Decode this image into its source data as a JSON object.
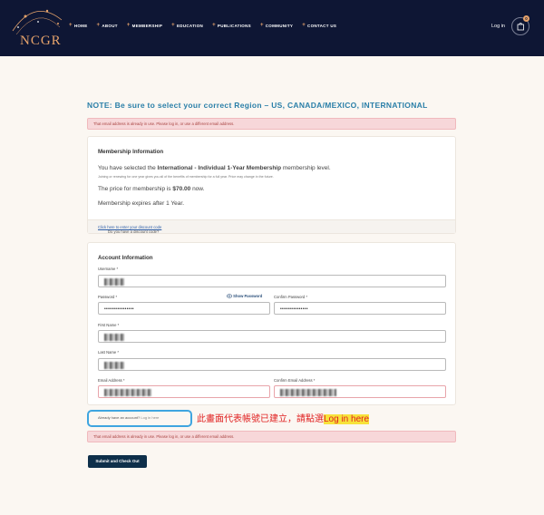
{
  "header": {
    "logo_text": "NCGR",
    "nav": [
      "HOME",
      "ABOUT",
      "MEMBERSHIP",
      "EDUCATION",
      "PUBLICATIONS",
      "COMMUNITY",
      "CONTACT US"
    ],
    "login": "Log in",
    "cart_count": "0",
    "bg_color": "#0e1634",
    "accent_color": "#e6a36b"
  },
  "notice": "NOTE: Be sure to select your correct Region – US, CANADA/MEXICO, INTERNATIONAL",
  "alert_text": "That email address is already in use. Please log in, or use a different email address.",
  "membership": {
    "title": "Membership Information",
    "selected_prefix": "You have selected the ",
    "level_name": "International - Individual 1-Year Membership",
    "selected_suffix": " membership level.",
    "fine_print": "Joining or renewing for one year gives you all of the benefits of membership for a full year. Price may change in the future.",
    "price_prefix": "The price for membership is ",
    "price": "$70.00",
    "price_suffix": " now.",
    "expires": "Membership expires after 1 Year.",
    "discount_prompt": "Do you have a discount code? ",
    "discount_link": "Click here to enter your discount code"
  },
  "account": {
    "title": "Account Information",
    "username_label": "Username *",
    "password_label": "Password *",
    "show_password": "Show Password",
    "confirm_password_label": "Confirm Password *",
    "password_value": "••••••••••••••••",
    "confirm_password_value": "•••••••••••••••",
    "first_name_label": "First Name *",
    "last_name_label": "Last Name *",
    "email_label": "Email Address *",
    "confirm_email_label": "Confirm Email Address *"
  },
  "already": {
    "text": "Already have an account? ",
    "link": "Log in here"
  },
  "annotation": {
    "text": "此畫面代表帳號已建立，請點選",
    "highlight": "Log in here"
  },
  "submit_label": "Submit and Check Out"
}
